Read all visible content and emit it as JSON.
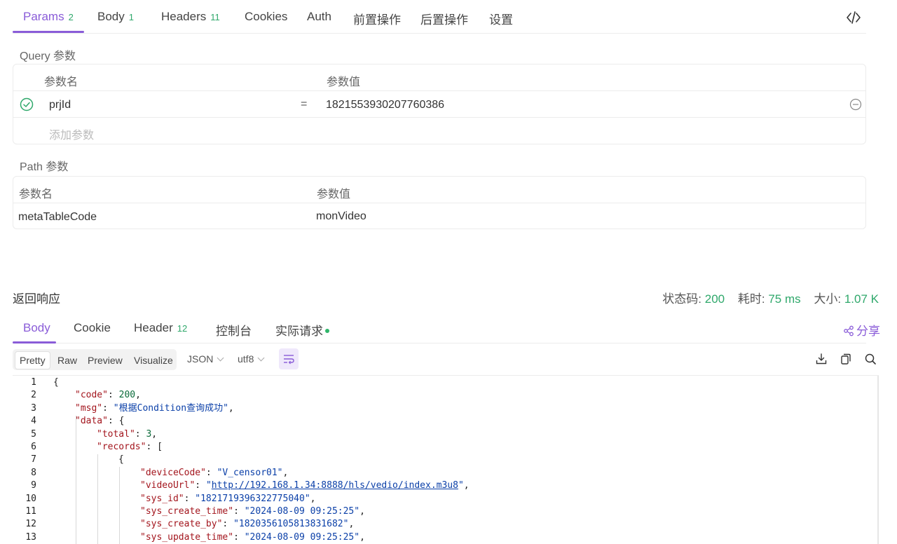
{
  "request_tabs": [
    {
      "label": "Params",
      "count": "2"
    },
    {
      "label": "Body",
      "count": "1"
    },
    {
      "label": "Headers",
      "count": "11"
    },
    {
      "label": "Cookies",
      "count": ""
    },
    {
      "label": "Auth",
      "count": ""
    },
    {
      "label": "前置操作",
      "count": ""
    },
    {
      "label": "后置操作",
      "count": ""
    },
    {
      "label": "设置",
      "count": ""
    }
  ],
  "query": {
    "title": "Query 参数",
    "col_name": "参数名",
    "col_value": "参数值",
    "rows": [
      {
        "name": "prjId",
        "equals": "=",
        "value": "1821553930207760386",
        "enabled": true
      }
    ],
    "add_placeholder": "添加参数"
  },
  "path": {
    "title": "Path 参数",
    "col_name": "参数名",
    "col_value": "参数值",
    "rows": [
      {
        "name": "metaTableCode",
        "value": "monVideo"
      }
    ]
  },
  "response": {
    "title": "返回响应",
    "status_label": "状态码:",
    "status_value": "200",
    "time_label": "耗时:",
    "time_value": "75 ms",
    "size_label": "大小:",
    "size_value": "1.07 K",
    "tabs": [
      {
        "label": "Body",
        "count": ""
      },
      {
        "label": "Cookie",
        "count": ""
      },
      {
        "label": "Header",
        "count": "12"
      },
      {
        "label": "控制台",
        "count": ""
      },
      {
        "label": "实际请求",
        "count": ""
      }
    ],
    "share_label": "分享",
    "view_modes": [
      "Pretty",
      "Raw",
      "Preview",
      "Visualize"
    ],
    "format": "JSON",
    "encoding": "utf8"
  },
  "code_lines": [
    {
      "n": "1",
      "indent": 0,
      "parts": [
        [
          "p",
          "{"
        ]
      ]
    },
    {
      "n": "2",
      "indent": 1,
      "parts": [
        [
          "k",
          "\"code\""
        ],
        [
          "p",
          ": "
        ],
        [
          "n",
          "200"
        ],
        [
          "p",
          ","
        ]
      ]
    },
    {
      "n": "3",
      "indent": 1,
      "parts": [
        [
          "k",
          "\"msg\""
        ],
        [
          "p",
          ": "
        ],
        [
          "s",
          "\"根据Condition查询成功\""
        ],
        [
          "p",
          ","
        ]
      ]
    },
    {
      "n": "4",
      "indent": 1,
      "parts": [
        [
          "k",
          "\"data\""
        ],
        [
          "p",
          ": {"
        ]
      ]
    },
    {
      "n": "5",
      "indent": 2,
      "parts": [
        [
          "k",
          "\"total\""
        ],
        [
          "p",
          ": "
        ],
        [
          "n",
          "3"
        ],
        [
          "p",
          ","
        ]
      ]
    },
    {
      "n": "6",
      "indent": 2,
      "parts": [
        [
          "k",
          "\"records\""
        ],
        [
          "p",
          ": ["
        ]
      ]
    },
    {
      "n": "7",
      "indent": 3,
      "parts": [
        [
          "p",
          "{"
        ]
      ]
    },
    {
      "n": "8",
      "indent": 4,
      "parts": [
        [
          "k",
          "\"deviceCode\""
        ],
        [
          "p",
          ": "
        ],
        [
          "s",
          "\"V_censor01\""
        ],
        [
          "p",
          ","
        ]
      ]
    },
    {
      "n": "9",
      "indent": 4,
      "parts": [
        [
          "k",
          "\"videoUrl\""
        ],
        [
          "p",
          ": "
        ],
        [
          "s",
          "\""
        ],
        [
          "u",
          "http://192.168.1.34:8888/hls/vedio/index.m3u8"
        ],
        [
          "s",
          "\""
        ],
        [
          "p",
          ","
        ]
      ]
    },
    {
      "n": "10",
      "indent": 4,
      "parts": [
        [
          "k",
          "\"sys_id\""
        ],
        [
          "p",
          ": "
        ],
        [
          "s",
          "\"1821719396322775040\""
        ],
        [
          "p",
          ","
        ]
      ]
    },
    {
      "n": "11",
      "indent": 4,
      "parts": [
        [
          "k",
          "\"sys_create_time\""
        ],
        [
          "p",
          ": "
        ],
        [
          "s",
          "\"2024-08-09 09:25:25\""
        ],
        [
          "p",
          ","
        ]
      ]
    },
    {
      "n": "12",
      "indent": 4,
      "parts": [
        [
          "k",
          "\"sys_create_by\""
        ],
        [
          "p",
          ": "
        ],
        [
          "s",
          "\"1820356105813831682\""
        ],
        [
          "p",
          ","
        ]
      ]
    },
    {
      "n": "13",
      "indent": 4,
      "parts": [
        [
          "k",
          "\"sys_update_time\""
        ],
        [
          "p",
          ": "
        ],
        [
          "s",
          "\"2024-08-09 09:25:25\""
        ],
        [
          "p",
          ","
        ]
      ]
    }
  ],
  "colors": {
    "accent": "#8a5cd8",
    "success": "#2fa86b",
    "json_key": "#a3151d",
    "json_string": "#0a3fa8",
    "json_number": "#0b6b3a"
  },
  "icons": {
    "code_view": "code-brackets-icon",
    "enabled": "check-circle-icon",
    "remove": "minus-circle-icon",
    "share": "share-icon",
    "wrap": "wrap-lines-icon",
    "download": "download-icon",
    "copy": "copy-icon",
    "search": "search-icon"
  }
}
